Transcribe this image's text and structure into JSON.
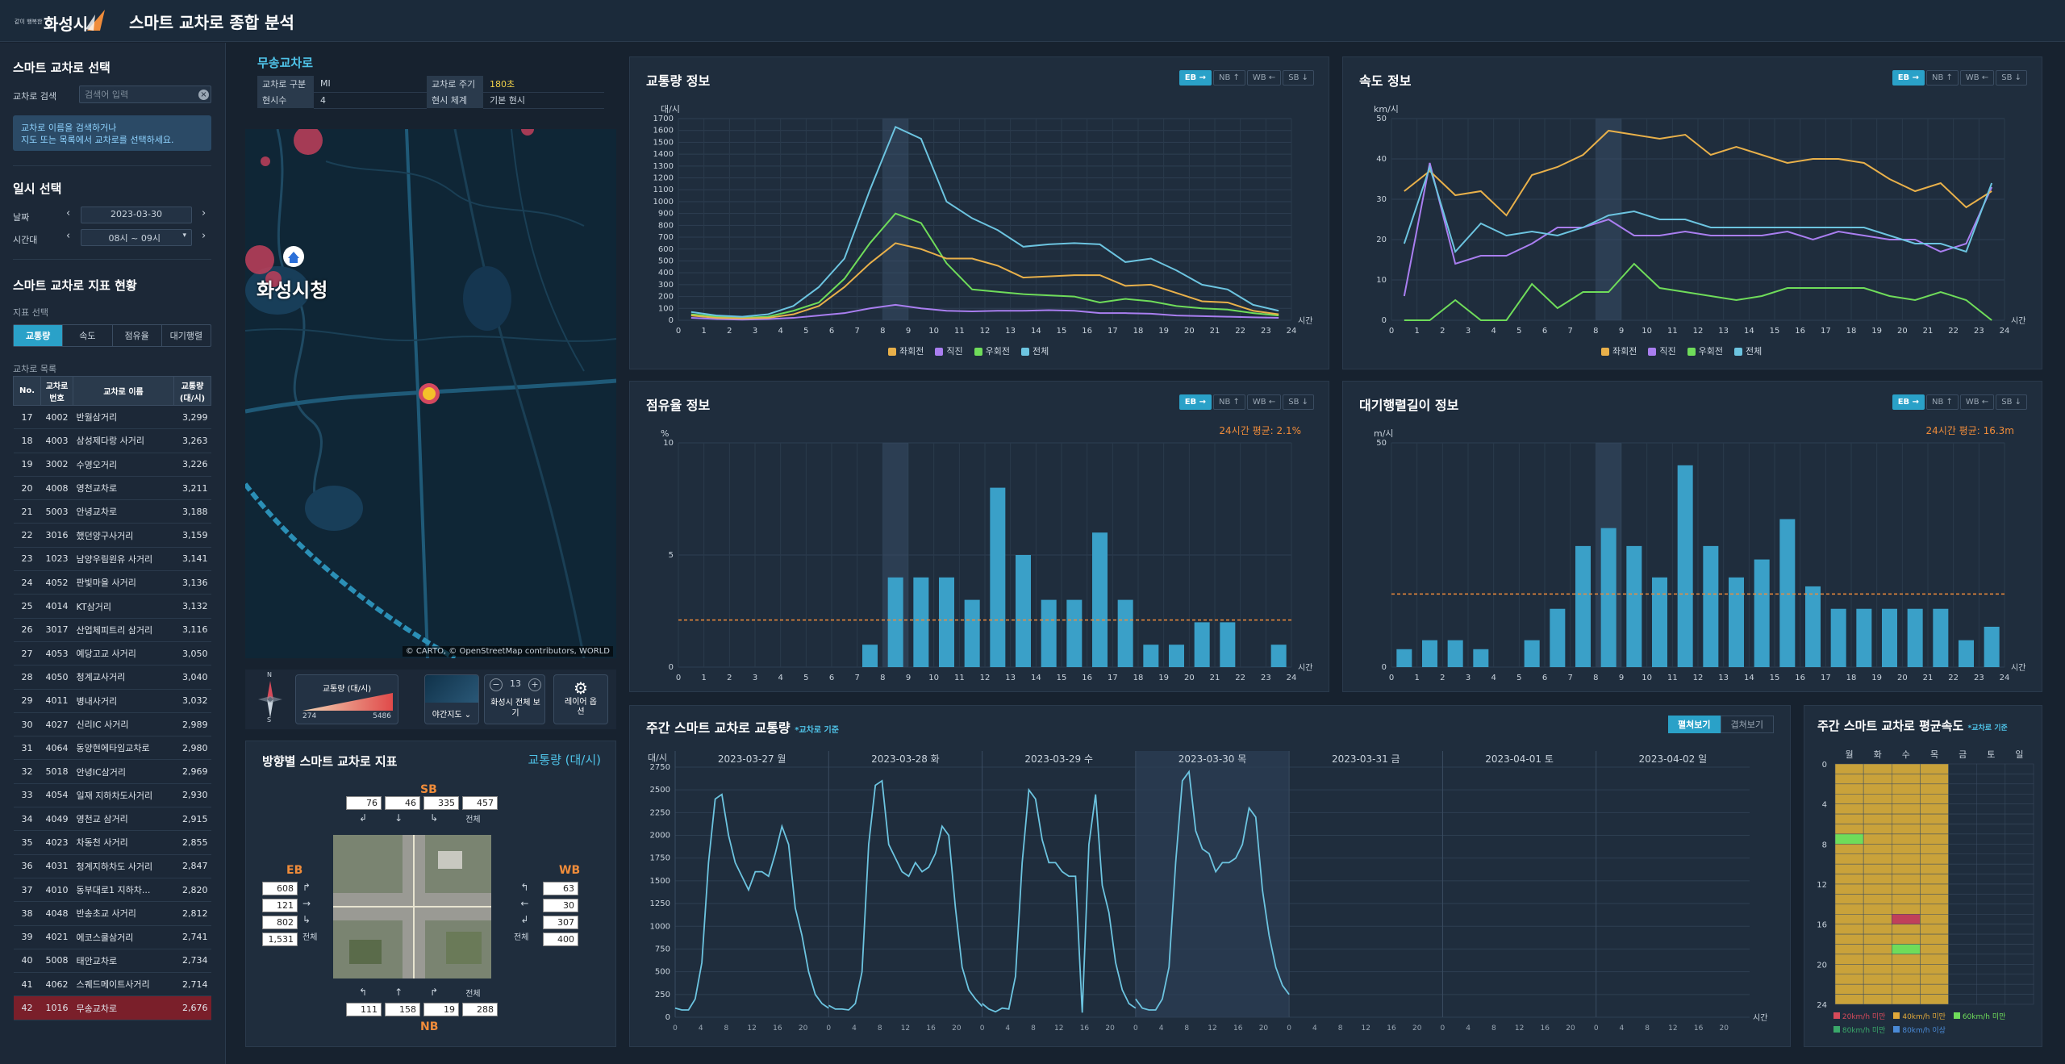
{
  "header": {
    "logo_sub": "같이 행복한",
    "logo_name": "화성시",
    "title": "스마트 교차로 종합 분석"
  },
  "sidebar": {
    "select_title": "스마트 교차로 선택",
    "search_label": "교차로 검색",
    "search_placeholder": "검색어 입력",
    "info_line1": "교차로 이름을 검색하거나",
    "info_line2": "지도 또는 목록에서 교차로를 선택하세요.",
    "date_title": "일시 선택",
    "date_label": "날짜",
    "date_value": "2023-03-30",
    "time_label": "시간대",
    "time_value": "08시 ~ 09시",
    "status_title": "스마트 교차로 지표 현황",
    "metric_label": "지표 선택",
    "metric_tabs": [
      "교통량",
      "속도",
      "점유율",
      "대기행렬"
    ],
    "list_label": "교차로 목록",
    "col_no": "No.",
    "col_id": "교차로 번호",
    "col_name": "교차로 이름",
    "col_vol": "교통량 (대/시)",
    "rows": [
      {
        "no": "17",
        "id": "4002",
        "name": "반월삼거리",
        "vol": "3,299"
      },
      {
        "no": "18",
        "id": "4003",
        "name": "삼성제다랑 사거리",
        "vol": "3,263"
      },
      {
        "no": "19",
        "id": "3002",
        "name": "수영오거리",
        "vol": "3,226"
      },
      {
        "no": "20",
        "id": "4008",
        "name": "영천교차로",
        "vol": "3,211"
      },
      {
        "no": "21",
        "id": "5003",
        "name": "안녕교차로",
        "vol": "3,188"
      },
      {
        "no": "22",
        "id": "3016",
        "name": "했던양구사거리",
        "vol": "3,159"
      },
      {
        "no": "23",
        "id": "1023",
        "name": "남양우림원유 사거리",
        "vol": "3,141"
      },
      {
        "no": "24",
        "id": "4052",
        "name": "판빛마을 사거리",
        "vol": "3,136"
      },
      {
        "no": "25",
        "id": "4014",
        "name": "KT삼거리",
        "vol": "3,132"
      },
      {
        "no": "26",
        "id": "3017",
        "name": "산업체피트리 삼거리",
        "vol": "3,116"
      },
      {
        "no": "27",
        "id": "4053",
        "name": "예당고교 사거리",
        "vol": "3,050"
      },
      {
        "no": "28",
        "id": "4050",
        "name": "청계교사거리",
        "vol": "3,040"
      },
      {
        "no": "29",
        "id": "4011",
        "name": "병내사거리",
        "vol": "3,032"
      },
      {
        "no": "30",
        "id": "4027",
        "name": "신리IC 사거리",
        "vol": "2,989"
      },
      {
        "no": "31",
        "id": "4064",
        "name": "동양현에타임교차로",
        "vol": "2,980"
      },
      {
        "no": "32",
        "id": "5018",
        "name": "안녕IC삼거리",
        "vol": "2,969"
      },
      {
        "no": "33",
        "id": "4054",
        "name": "일재 지하차도사거리",
        "vol": "2,930"
      },
      {
        "no": "34",
        "id": "4049",
        "name": "영천교 삼거리",
        "vol": "2,915"
      },
      {
        "no": "35",
        "id": "4023",
        "name": "차동천 사거리",
        "vol": "2,855"
      },
      {
        "no": "36",
        "id": "4031",
        "name": "청계지하차도 사거리",
        "vol": "2,847"
      },
      {
        "no": "37",
        "id": "4010",
        "name": "동부대로1 지하차...",
        "vol": "2,820"
      },
      {
        "no": "38",
        "id": "4048",
        "name": "반송초교 사거리",
        "vol": "2,812"
      },
      {
        "no": "39",
        "id": "4021",
        "name": "에코스쿨삼거리",
        "vol": "2,741"
      },
      {
        "no": "40",
        "id": "5008",
        "name": "태안교차로",
        "vol": "2,734"
      },
      {
        "no": "41",
        "id": "4062",
        "name": "스퀘드메이트사거리",
        "vol": "2,714"
      },
      {
        "no": "42",
        "id": "1016",
        "name": "무송교차로",
        "vol": "2,676"
      }
    ]
  },
  "intersection": {
    "name": "무송교차로",
    "k1": "교차로 구분",
    "v1": "MI",
    "k2": "교차로 주기",
    "v2": "180초",
    "k3": "현시수",
    "v3": "4",
    "k4": "현시 체계",
    "v4": "기본 현시"
  },
  "map": {
    "city_label": "화성시청",
    "attribution": "© CARTO, © OpenStreetMap contributors, WORLD",
    "legend_title": "교통량 (대/시)",
    "legend_min": "274",
    "legend_max": "5486",
    "basemap": "야간지도",
    "zoom": "13",
    "fullview": "화성시 전체 보기",
    "layer": "레이어 옵션",
    "compass_n": "N",
    "compass_s": "S"
  },
  "direction": {
    "title": "방향별 스마트 교차로 지표",
    "metric": "교통량 (대/시)",
    "sb": {
      "label": "SB",
      "vals": [
        "76",
        "46",
        "335",
        "457"
      ],
      "total": "전체"
    },
    "eb": {
      "label": "EB",
      "vals": [
        "608",
        "121",
        "802",
        "1,531"
      ],
      "total": "전체"
    },
    "wb": {
      "label": "WB",
      "vals": [
        "63",
        "30",
        "307",
        "400"
      ],
      "total": "전체"
    },
    "nb": {
      "label": "NB",
      "vals": [
        "111",
        "158",
        "19",
        "288"
      ],
      "total": "전체"
    }
  },
  "dir_buttons": [
    "EB →",
    "NB ↑",
    "WB ←",
    "SB ↓"
  ],
  "charts": {
    "vol": {
      "title": "교통량 정보",
      "yunit": "대/시",
      "xunit": "시간",
      "legend": [
        "좌회전",
        "직진",
        "우회전",
        "전체"
      ],
      "colors": [
        "#e8b04a",
        "#a97ef0",
        "#6fdc5a",
        "#6cc4e0"
      ],
      "left": [
        0,
        1,
        2,
        3,
        4,
        5,
        6,
        7,
        8,
        9,
        10,
        11,
        12,
        13,
        14,
        15,
        16,
        17,
        18,
        19,
        20,
        21,
        22,
        23
      ],
      "straight": [
        20,
        10,
        5,
        10,
        20,
        40,
        60,
        100,
        130,
        100,
        80,
        75,
        80,
        80,
        85,
        80,
        60,
        60,
        55,
        40,
        35,
        30,
        25,
        20
      ],
      "right": [
        50,
        30,
        20,
        30,
        80,
        150,
        350,
        650,
        900,
        820,
        480,
        260,
        240,
        220,
        210,
        200,
        150,
        180,
        160,
        120,
        100,
        90,
        60,
        40
      ],
      "total": [
        70,
        40,
        30,
        50,
        120,
        280,
        520,
        1100,
        1630,
        1530,
        1000,
        860,
        760,
        620,
        640,
        650,
        640,
        490,
        520,
        420,
        300,
        260,
        130,
        80
      ],
      "leftv": [
        40,
        20,
        15,
        20,
        50,
        120,
        280,
        480,
        650,
        600,
        520,
        520,
        460,
        360,
        370,
        380,
        380,
        290,
        300,
        230,
        160,
        150,
        80,
        50
      ],
      "ymax": 1700
    },
    "speed": {
      "title": "속도 정보",
      "yunit": "km/시",
      "xunit": "시간",
      "legend": [
        "좌회전",
        "직진",
        "우회전",
        "전체"
      ],
      "ymax": 50
    },
    "occ": {
      "title": "점유율 정보",
      "yunit": "%",
      "xunit": "시간",
      "avg": "24시간 평균: 2.1%",
      "avg_v": 2.1,
      "ymax": 10,
      "bars": [
        0,
        0,
        0,
        0,
        0,
        0,
        0,
        1,
        4,
        4,
        4,
        3,
        8,
        5,
        3,
        3,
        6,
        3,
        1,
        1,
        2,
        2,
        0,
        1
      ]
    },
    "queue": {
      "title": "대기행렬길이 정보",
      "yunit": "m/시",
      "xunit": "시간",
      "avg": "24시간 평균: 16.3m",
      "avg_v": 16.3,
      "ymax": 50,
      "bars": [
        4,
        6,
        6,
        4,
        0,
        6,
        13,
        27,
        31,
        27,
        20,
        45,
        27,
        20,
        24,
        33,
        18,
        13,
        13,
        13,
        13,
        13,
        6,
        9
      ]
    },
    "weekly": {
      "title": "주간 스마트 교차로 교통량",
      "note": "*교차로 기준",
      "yunit": "대/시",
      "xunit": "시간",
      "view_a": "펼쳐보기",
      "view_b": "겹쳐보기",
      "days": [
        "2023-03-27 월",
        "2023-03-28 화",
        "2023-03-29 수",
        "2023-03-30 목",
        "2023-03-31 금",
        "2023-04-01 토",
        "2023-04-02 일"
      ],
      "ymax": 2750
    },
    "wspeed": {
      "title": "주간 스마트 교차로 평균속도",
      "note": "*교차로 기준",
      "days": [
        "월",
        "화",
        "수",
        "목",
        "금",
        "토",
        "일"
      ],
      "legend": [
        "20km/h 미만",
        "40km/h 미만",
        "60km/h 미만",
        "80km/h 미만",
        "80km/h 이상"
      ],
      "legend_colors": [
        "#d64a5a",
        "#e0a83a",
        "#6fdc5a",
        "#3aa86a",
        "#4a8ad6"
      ]
    }
  }
}
